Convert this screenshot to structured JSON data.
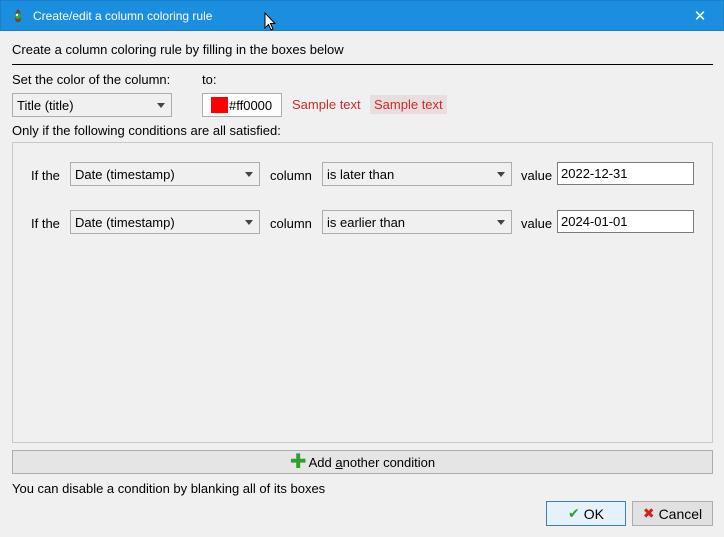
{
  "window": {
    "title": "Create/edit a column coloring rule",
    "close_glyph": "✕",
    "icon": "calibre-icon"
  },
  "heading": "Create a column coloring rule by filling in the boxes below",
  "set_color_label": "Set the color of the column:",
  "to_label": "to:",
  "column_select": {
    "value": "Title (title)"
  },
  "color": {
    "value": "#ff0000",
    "hex_label": "#ff0000"
  },
  "samples": [
    "Sample text",
    "Sample text"
  ],
  "conditions_label": "Only if the following conditions are all satisfied:",
  "conditions": [
    {
      "if_label": "If the",
      "column": "Date (timestamp)",
      "column_label": "column",
      "operator": "is later than",
      "value_label": "value",
      "value": "2022-12-31"
    },
    {
      "if_label": "If the",
      "column": "Date (timestamp)",
      "column_label": "column",
      "operator": "is earlier than",
      "value_label": "value",
      "value": "2024-01-01"
    }
  ],
  "add_condition": {
    "label_pre": "Add ",
    "label_accel": "a",
    "label_post": "nother condition"
  },
  "hint": "You can disable a condition by blanking all of its boxes",
  "buttons": {
    "ok": "OK",
    "cancel": "Cancel"
  }
}
